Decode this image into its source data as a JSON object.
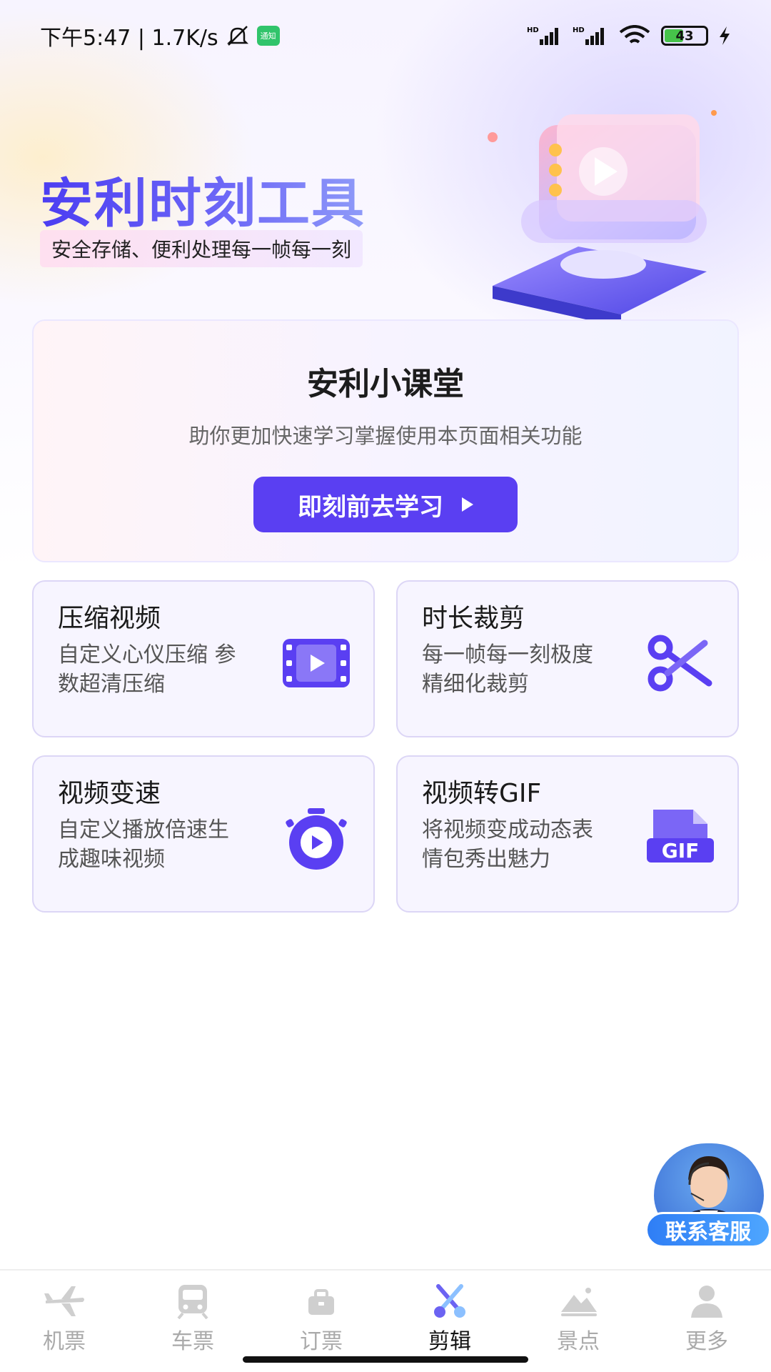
{
  "status_bar": {
    "time_and_speed": "下午5:47 | 1.7K/s",
    "app_badge": "通知",
    "battery": "43"
  },
  "hero": {
    "title": "安利时刻工具",
    "subtitle": "安全存储、便利处理每一帧每一刻"
  },
  "course": {
    "title": "安利小课堂",
    "description": "助你更加快速学习掌握使用本页面相关功能",
    "button_label": "即刻前去学习"
  },
  "features": [
    {
      "title": "压缩视频",
      "description": "自定义心仪压缩 参数超清压缩",
      "icon": "video-film-icon"
    },
    {
      "title": "时长裁剪",
      "description": "每一帧每一刻极度精细化裁剪",
      "icon": "scissors-icon"
    },
    {
      "title": "视频变速",
      "description": "自定义播放倍速生成趣味视频",
      "icon": "stopwatch-play-icon"
    },
    {
      "title": "视频转GIF",
      "description": "将视频变成动态表情包秀出魅力",
      "icon": "gif-file-icon"
    }
  ],
  "customer_service": {
    "label": "联系客服"
  },
  "bottom_nav": [
    {
      "label": "机票",
      "icon": "airplane-icon",
      "active": false
    },
    {
      "label": "车票",
      "icon": "train-icon",
      "active": false
    },
    {
      "label": "订票",
      "icon": "briefcase-icon",
      "active": false
    },
    {
      "label": "剪辑",
      "icon": "scissors-icon",
      "active": true
    },
    {
      "label": "景点",
      "icon": "mountain-icon",
      "active": false
    },
    {
      "label": "更多",
      "icon": "person-icon",
      "active": false
    }
  ],
  "colors": {
    "accent": "#5a3ff2",
    "inactive_nav": "#aaaaaa",
    "cs_blue": "#2f7ef5"
  }
}
